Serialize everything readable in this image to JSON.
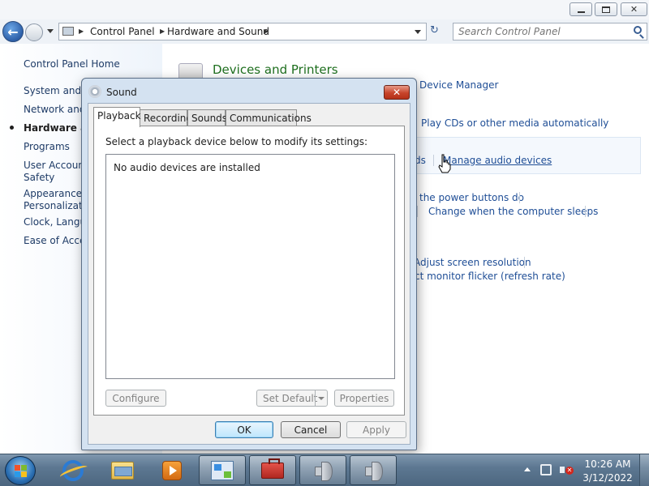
{
  "explorer": {
    "breadcrumbs": [
      "Control Panel",
      "Hardware and Sound"
    ],
    "search_placeholder": "Search Control Panel",
    "left_pane": {
      "home": "Control Panel Home",
      "items": [
        {
          "line1": "System and S",
          "line2": ""
        },
        {
          "line1": "Network and",
          "line2": ""
        },
        {
          "line1": "Hardware an",
          "line2": "",
          "current": true
        },
        {
          "line1": "Programs",
          "line2": ""
        },
        {
          "line1": "User Account",
          "line2": "Safety"
        },
        {
          "line1": "Appearance a",
          "line2": "Personalizatio"
        },
        {
          "line1": "Clock, Langua",
          "line2": ""
        },
        {
          "line1": "Ease of Acces",
          "line2": ""
        }
      ]
    },
    "content": {
      "category_title": "Devices and Printers",
      "links": {
        "device_manager": "Device Manager",
        "play_cds": "Play CDs or other media automatically",
        "sounds_fragment": "ds",
        "manage_audio": "Manage audio devices",
        "power_buttons": "the power buttons do",
        "computer_sleeps": "Change when the computer sleeps",
        "adjust_resolution": "Adjust screen resolution",
        "monitor_flicker": "ct monitor flicker (refresh rate)"
      }
    }
  },
  "dialog": {
    "title": "Sound",
    "tabs": [
      "Playback",
      "Recording",
      "Sounds",
      "Communications"
    ],
    "active_tab": "Playback",
    "instruction": "Select a playback device below to modify its settings:",
    "empty_message": "No audio devices are installed",
    "buttons": {
      "configure": "Configure",
      "set_default": "Set Default",
      "properties": "Properties",
      "ok": "OK",
      "cancel": "Cancel",
      "apply": "Apply"
    }
  },
  "taskbar": {
    "time": "10:26 AM",
    "date": "3/12/2022"
  },
  "colors": {
    "link": "#1f4e96",
    "category_title": "#1e6f1e",
    "close_button": "#c7442b"
  }
}
